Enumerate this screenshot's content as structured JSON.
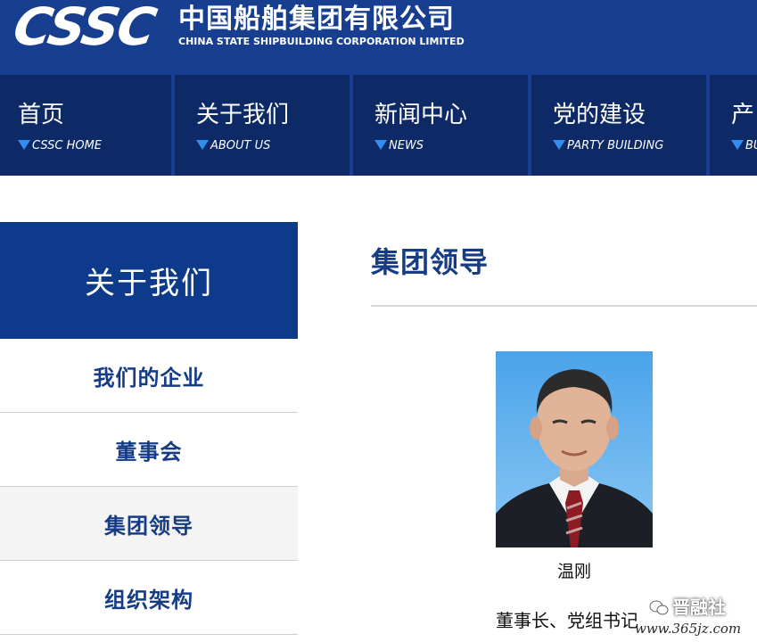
{
  "header": {
    "logo_mark": "CSSC",
    "logo_cn": "中国船舶集团有限公司",
    "logo_en": "CHINA STATE SHIPBUILDING CORPORATION LIMITED"
  },
  "nav": {
    "items": [
      {
        "cn": "首页",
        "en": "CSSC HOME"
      },
      {
        "cn": "关于我们",
        "en": "ABOUT US"
      },
      {
        "cn": "新闻中心",
        "en": "NEWS"
      },
      {
        "cn": "党的建设",
        "en": "PARTY BUILDING"
      },
      {
        "cn": "产",
        "en": "BU"
      }
    ]
  },
  "sidebar": {
    "heading": "关于我们",
    "items": [
      {
        "label": "我们的企业"
      },
      {
        "label": "董事会"
      },
      {
        "label": "集团领导"
      },
      {
        "label": "组织架构"
      }
    ]
  },
  "main": {
    "page_title": "集团领导",
    "person": {
      "name": "温刚",
      "title": "董事长、党组书记"
    }
  },
  "watermark": {
    "brand": "晋融社",
    "url": "www.365jz.com"
  },
  "colors": {
    "header_bg": "#183f8f",
    "nav_bg": "#0d2a66",
    "sidebar_head_bg": "#0d3a8a",
    "link_text": "#163c86",
    "nav_triangle": "#2e8ff0"
  }
}
